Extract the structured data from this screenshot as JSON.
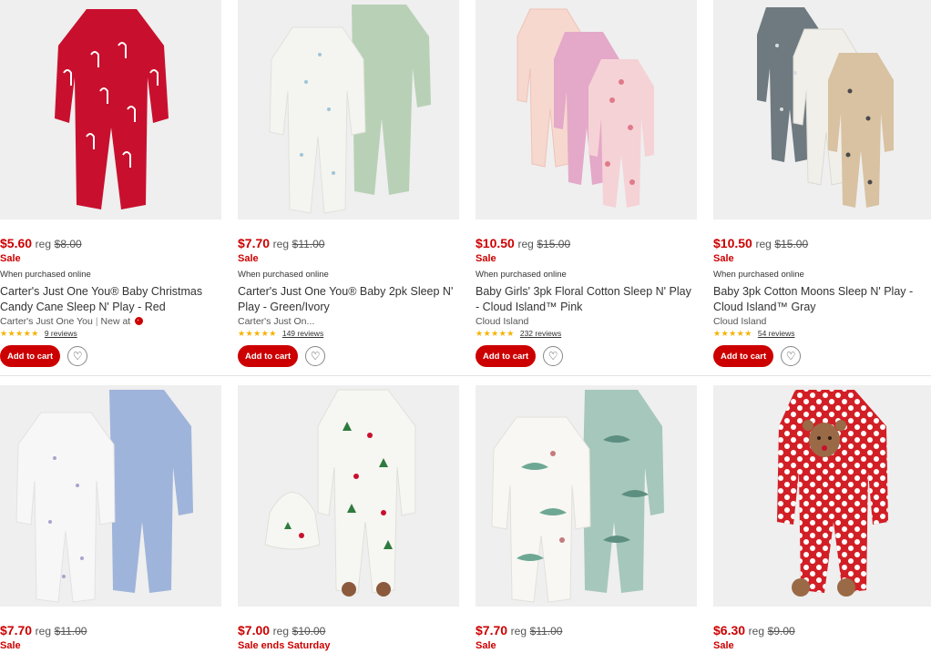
{
  "products": [
    {
      "price": "$5.60",
      "reg_label": "reg",
      "reg_price": "$8.00",
      "sale": "Sale",
      "online_note": "When purchased online",
      "title": "Carter's Just One You® Baby Christmas Candy Cane Sleep N' Play - Red",
      "brand": "Carter's Just One You",
      "new_at": "New at",
      "stars": "★★★★★",
      "reviews": "9 reviews",
      "cta": "Add to cart",
      "favorite_icon": "heart-icon",
      "image": "red candy cane footed sleeper",
      "color": "#c8102e"
    },
    {
      "price": "$7.70",
      "reg_label": "reg",
      "reg_price": "$11.00",
      "sale": "Sale",
      "online_note": "When purchased online",
      "title": "Carter's Just One You® Baby 2pk Sleep N' Play - Green/Ivory",
      "brand": "Carter's Just On...",
      "stars": "★★★★★",
      "reviews": "149 reviews",
      "cta": "Add to cart",
      "favorite_icon": "heart-icon",
      "image": "ivory and sage green sleepers",
      "color": "#b8d1b6"
    },
    {
      "price": "$10.50",
      "reg_label": "reg",
      "reg_price": "$15.00",
      "sale": "Sale",
      "online_note": "When purchased online",
      "title": "Baby Girls' 3pk Floral Cotton Sleep N' Play - Cloud Island™ Pink",
      "brand": "Cloud Island",
      "stars": "★★★★★",
      "reviews": "232 reviews",
      "cta": "Add to cart",
      "favorite_icon": "heart-icon",
      "image": "pink floral sleepers",
      "color": "#e9b2c4"
    },
    {
      "price": "$10.50",
      "reg_label": "reg",
      "reg_price": "$15.00",
      "sale": "Sale",
      "online_note": "When purchased online",
      "title": "Baby 3pk Cotton Moons Sleep N' Play - Cloud Island™ Gray",
      "brand": "Cloud Island",
      "stars": "★★★★★",
      "reviews": "54 reviews",
      "cta": "Add to cart",
      "favorite_icon": "heart-icon",
      "image": "gray and tan moon sleepers",
      "color": "#6e7a80"
    },
    {
      "price": "$7.70",
      "reg_label": "reg",
      "reg_price": "$11.00",
      "sale": "Sale",
      "image": "white and blue sleepers",
      "color": "#9fb4da"
    },
    {
      "price": "$7.00",
      "reg_label": "reg",
      "reg_price": "$10.00",
      "sale": "Sale ends Saturday",
      "image": "holiday print sleeper with hat",
      "color": "#f6f6f2"
    },
    {
      "price": "$7.70",
      "reg_label": "reg",
      "reg_price": "$11.00",
      "sale": "Sale",
      "image": "dinosaur print sleepers",
      "color": "#a6c7bc"
    },
    {
      "price": "$6.30",
      "reg_label": "reg",
      "reg_price": "$9.00",
      "sale": "Sale",
      "image": "red polka dot reindeer sleeper",
      "color": "#d21f26"
    }
  ],
  "colors": {
    "sale_red": "#cc0000",
    "star_gold": "#f5b301",
    "image_bg": "#efefef"
  }
}
